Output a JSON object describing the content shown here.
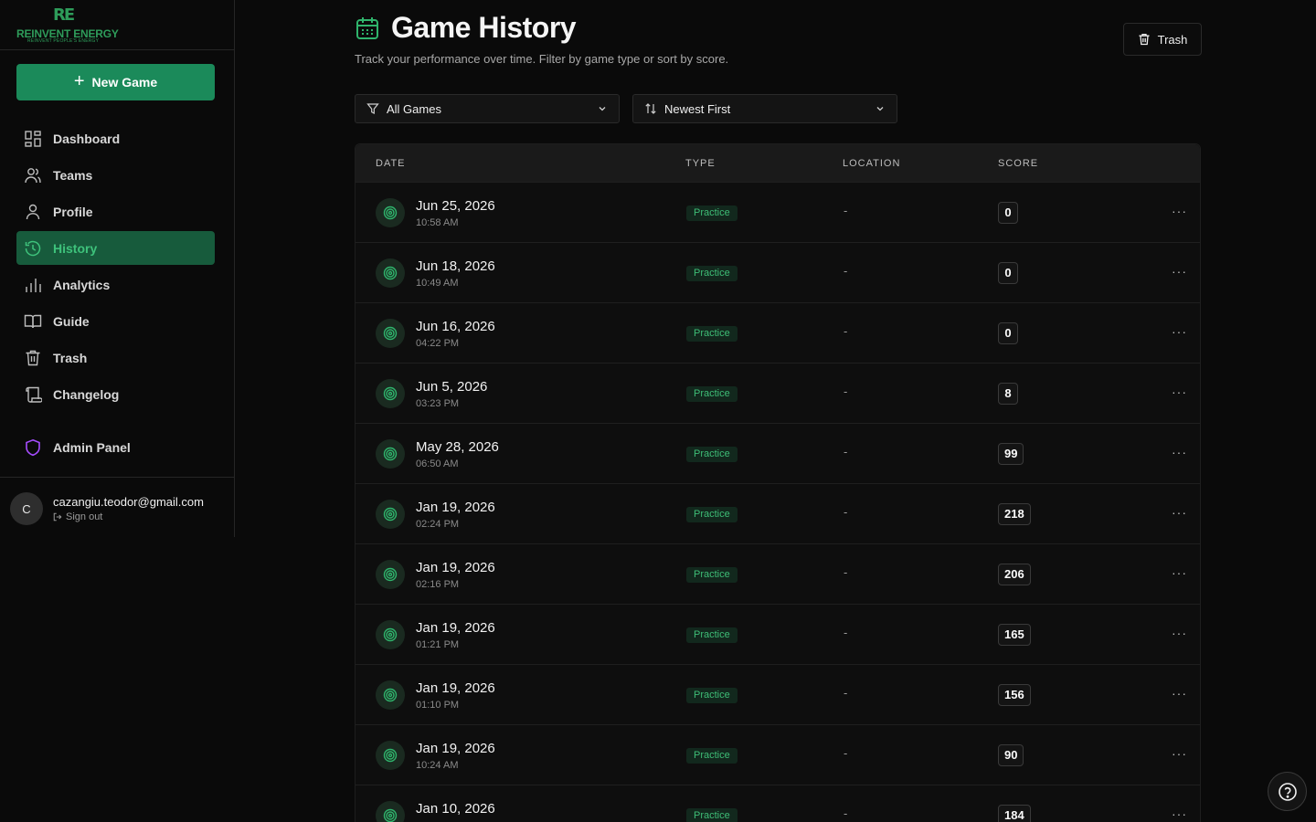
{
  "brand": {
    "mark": "RE",
    "name": "REINVENT ENERGY",
    "tagline": "REINVENT PEOPLE'S ENERGY",
    "accent": "#1b8a5a"
  },
  "sidebar": {
    "new_game_label": "New Game",
    "items": [
      {
        "label": "Dashboard",
        "icon": "dashboard-icon"
      },
      {
        "label": "Teams",
        "icon": "users-icon"
      },
      {
        "label": "Profile",
        "icon": "user-icon"
      },
      {
        "label": "History",
        "icon": "history-icon",
        "active": true
      },
      {
        "label": "Analytics",
        "icon": "bar-chart-icon"
      },
      {
        "label": "Guide",
        "icon": "book-icon"
      },
      {
        "label": "Trash",
        "icon": "trash-icon"
      },
      {
        "label": "Changelog",
        "icon": "scroll-icon"
      }
    ],
    "admin_label": "Admin Panel",
    "user": {
      "initial": "C",
      "email": "cazangiu.teodor@gmail.com",
      "sign_out": "Sign out"
    }
  },
  "header": {
    "title": "Game History",
    "subtitle": "Track your performance over time. Filter by game type or sort by score.",
    "trash_label": "Trash"
  },
  "filters": {
    "game_filter": "All Games",
    "sort": "Newest First"
  },
  "table": {
    "columns": [
      "DATE",
      "TYPE",
      "LOCATION",
      "SCORE"
    ],
    "rows": [
      {
        "date": "Jun 25, 2026",
        "time": "10:58 AM",
        "type": "Practice",
        "location": "-",
        "score": "0"
      },
      {
        "date": "Jun 18, 2026",
        "time": "10:49 AM",
        "type": "Practice",
        "location": "-",
        "score": "0"
      },
      {
        "date": "Jun 16, 2026",
        "time": "04:22 PM",
        "type": "Practice",
        "location": "-",
        "score": "0"
      },
      {
        "date": "Jun 5, 2026",
        "time": "03:23 PM",
        "type": "Practice",
        "location": "-",
        "score": "8"
      },
      {
        "date": "May 28, 2026",
        "time": "06:50 AM",
        "type": "Practice",
        "location": "-",
        "score": "99"
      },
      {
        "date": "Jan 19, 2026",
        "time": "02:24 PM",
        "type": "Practice",
        "location": "-",
        "score": "218"
      },
      {
        "date": "Jan 19, 2026",
        "time": "02:16 PM",
        "type": "Practice",
        "location": "-",
        "score": "206"
      },
      {
        "date": "Jan 19, 2026",
        "time": "01:21 PM",
        "type": "Practice",
        "location": "-",
        "score": "165"
      },
      {
        "date": "Jan 19, 2026",
        "time": "01:10 PM",
        "type": "Practice",
        "location": "-",
        "score": "156"
      },
      {
        "date": "Jan 19, 2026",
        "time": "10:24 AM",
        "type": "Practice",
        "location": "-",
        "score": "90"
      },
      {
        "date": "Jan 10, 2026",
        "time": "",
        "type": "Practice",
        "location": "-",
        "score": "184"
      }
    ]
  }
}
